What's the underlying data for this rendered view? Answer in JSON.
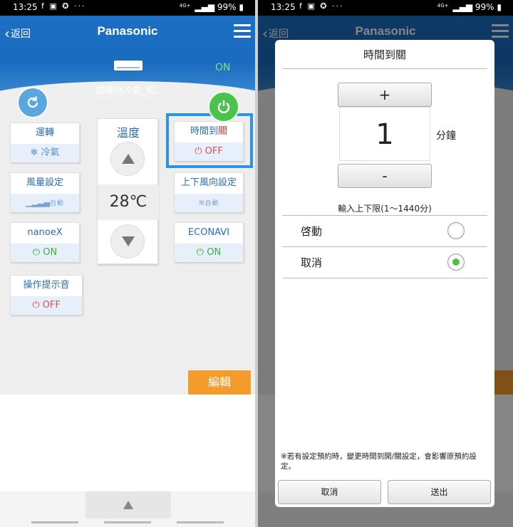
{
  "status_bar": {
    "time": "13:25",
    "icons": "f ▣ ✪ ···",
    "network": "4G+",
    "signal": "▂▄▆",
    "battery": "99%"
  },
  "header": {
    "back_label": "返回",
    "brand": "Panasonic",
    "device_name": "國際PX冷氣_兒..",
    "power_state": "ON"
  },
  "temperature": {
    "label": "溫度",
    "value": "28℃"
  },
  "tiles": {
    "operation": {
      "label": "運轉",
      "value": "❄ 冷氣"
    },
    "airflow": {
      "label": "風量設定",
      "value": "自動"
    },
    "nanoe": {
      "label": "nanoeX",
      "value": "ON"
    },
    "sound": {
      "label": "操作提示音",
      "value": "OFF"
    },
    "timer": {
      "label_a": "時間到",
      "label_b": "關",
      "value": "OFF"
    },
    "vane": {
      "label": "上下風向設定",
      "value": "自動"
    },
    "econavi": {
      "label": "ECONAVI",
      "value": "ON"
    }
  },
  "edit_label": "編輯",
  "dialog": {
    "title": "時間到關",
    "increment_label": "+",
    "decrement_label": "-",
    "value": "1",
    "unit": "分鐘",
    "range_hint": "輸入上下限(1〜1440分)",
    "options": [
      {
        "label": "啓動",
        "selected": false
      },
      {
        "label": "取消",
        "selected": true
      }
    ],
    "footnote": "※若有設定預約時，變更時間到開/關設定，會影響原預約設定。",
    "cancel_label": "取消",
    "submit_label": "送出"
  },
  "colors": {
    "header_blue": "#1a6bbf",
    "power_green": "#4bc24b",
    "edit_orange": "#f39b2b",
    "highlight_blue": "#2b94e8",
    "radio_green": "#4cc23f"
  }
}
